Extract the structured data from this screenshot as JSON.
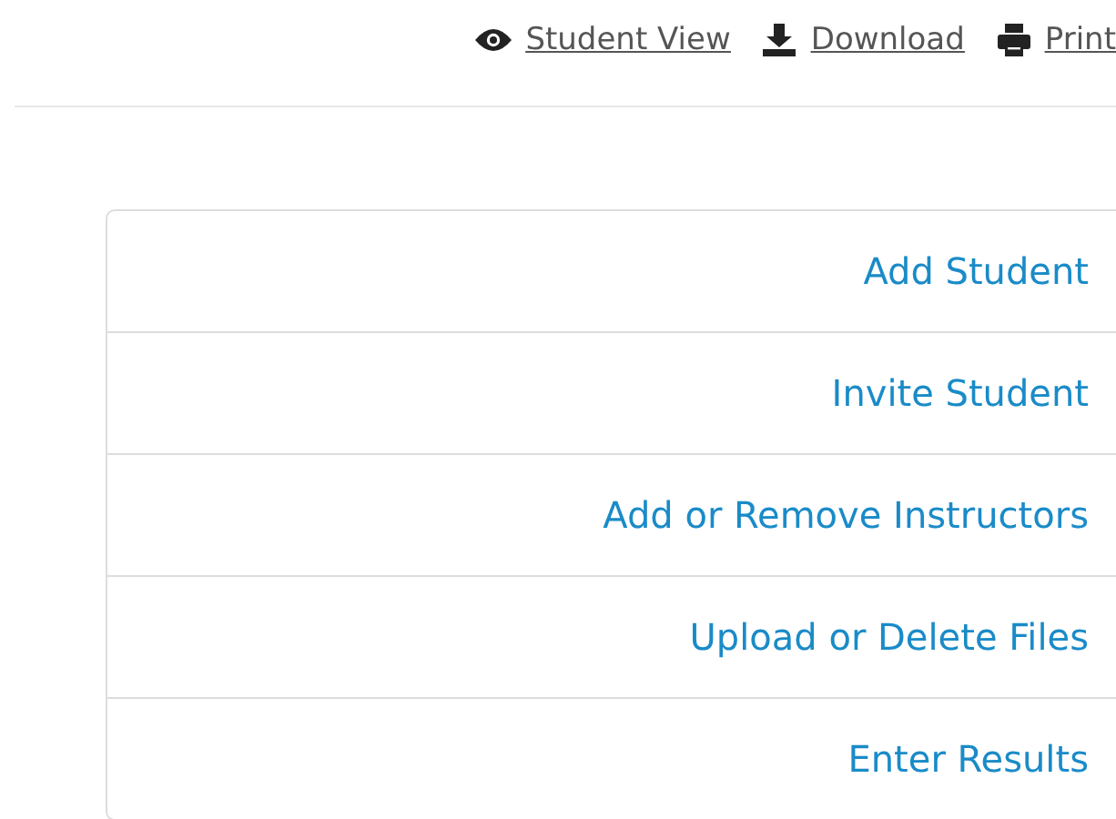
{
  "toolbar": [
    {
      "kind": "eye",
      "label": "Student View"
    },
    {
      "kind": "download",
      "label": "Download"
    },
    {
      "kind": "print",
      "label": "Print"
    }
  ],
  "actions": [
    "Add Student",
    "Invite Student",
    "Add or Remove Instructors",
    "Upload or Delete Files",
    "Enter Results"
  ]
}
